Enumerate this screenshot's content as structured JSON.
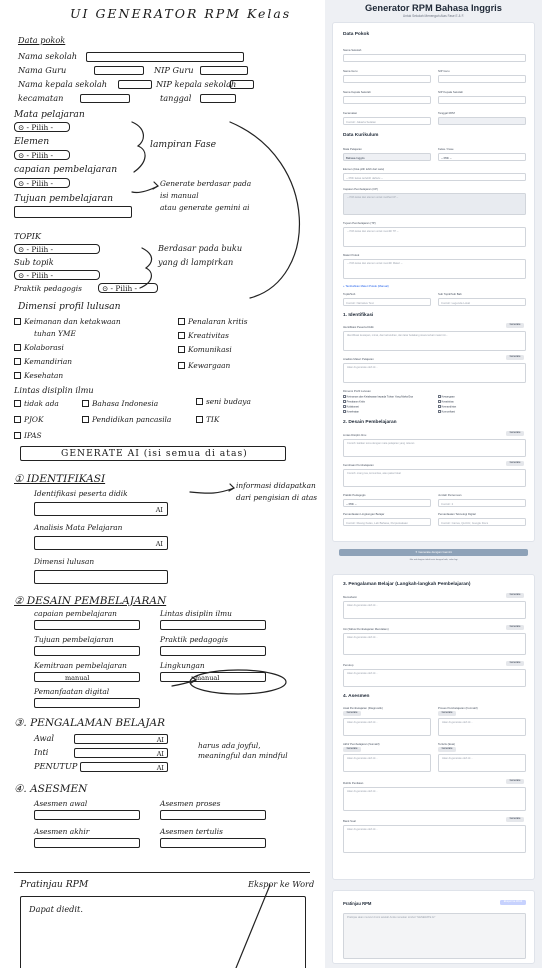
{
  "sketch": {
    "title": "UI GENERATOR RPM Kelas",
    "data_pokok": "Data pokok",
    "nama_sekolah": "Nama sekolah",
    "nama_guru": "Nama Guru",
    "nip_guru": "NIP Guru",
    "nama_kepsek": "Nama kepala sekolah",
    "nip_kepsek": "NIP kepala sekolah",
    "kecamatan": "kecamatan",
    "tanggal": "tanggal",
    "mata_pelajaran": "Mata pelajaran",
    "pilih": "⊙ - Pilih -",
    "elemen": "Elemen",
    "capaian": "capaian pembelajaran",
    "tujuan": "Tujuan pembelajaran",
    "lampiran_fase": "lampiran Fase",
    "generate_note1": "Generate berdasar pada",
    "generate_note2": "isi manual",
    "generate_note3": "atau generate gemini ai",
    "topik": "TOPIK",
    "sub_topik": "Sub topik",
    "praktik": "Praktik pedagogis",
    "buku_note1": "Berdasar pada buku",
    "buku_note2": "yang di lampirkan",
    "dimensi": "Dimensi profil lulusan",
    "dim_items": [
      "Keimanan dan ketakwaan",
      "tuhan YME",
      "Kolaborasi",
      "Kemandirian",
      "Kesehatan",
      "Penalaran kritis",
      "Kreativitas",
      "Komunikasi",
      "Kewargaan"
    ],
    "lintas": "Lintas disiplin ilmu",
    "lintas_items": [
      "tidak ada",
      "Bahasa Indonesia",
      "seni budaya",
      "PJOK",
      "Pendidikan pancasila",
      "TIK",
      "IPAS"
    ],
    "generate_ai": "GENERATE AI (isi semua di atas)",
    "s1": "① IDENTIFIKASI",
    "identifikasi_peserta": "Identifikasi peserta didik",
    "analisis_mapel": "Analisis Mata Pelajaran",
    "dimensi_lulusan": "Dimensi lulusan",
    "ai": "AI",
    "info_note1": "informasi didapatkan",
    "info_note2": "dari pengisian di atas",
    "s2": "② DESAIN PEMBELAJARAN",
    "capaian_pemb": "capaian pembelajaran",
    "lintas_ilmu": "Lintas disiplin ilmu",
    "tujuan_pemb": "Tujuan pembelajaran",
    "praktik_ped": "Praktik pedagogis",
    "kemitraan": "Kemitraan pembelajaran",
    "lingkungan": "Lingkungan",
    "manual": "manual",
    "pemanfaatan": "Pemanfaatan digital",
    "s3": "③. PENGALAMAN BELAJAR",
    "awal": "Awal",
    "inti": "Inti",
    "penutup": "PENUTUP",
    "joyful_note1": "harus ada joyful,",
    "joyful_note2": "meaningful dan mindful",
    "s4": "④. ASESMEN",
    "asesmen_awal": "Asesmen awal",
    "asesmen_proses": "Asesmen proses",
    "asesmen_akhir": "Asesmen akhir",
    "asesmen_tertulis": "Asesmen tertulis",
    "pratinjau": "Pratinjau RPM",
    "ekspor": "Ekspor ke Word",
    "dapat_diedit": "Dapat diedit."
  },
  "app": {
    "title": "Generator RPM Bahasa Inggris",
    "subtitle": "Untuk Sekolah Menengah Atas Fase E & F.",
    "data_pokok": "Data Pokok",
    "nama_sekolah": "Nama Sekolah",
    "nama_guru": "Nama Guru",
    "nip_guru": "NIP Guru",
    "nama_kepsek": "Nama Kepala Sekolah",
    "nip_kepsek": "NIP Kepala Sekolah",
    "kecamatan": "Kecamatan",
    "kecamatan_ph": "Contoh: Jakarta Selatan",
    "tanggal": "Tanggal RPM",
    "data_kurikulum": "Data Kurikulum",
    "mata_pelajaran": "Mata Pelajaran",
    "mapel_value": "Bahasa Inggris",
    "kelas": "Kelas / Fase",
    "kelas_value": "-- Pilih --",
    "elemen": "Elemen (bisa pilih lebih dari satu)",
    "elemen_value": "-- Pilih kelas terlebih dahulu --",
    "capaian": "Capaian Pembelajaran (CP)",
    "capaian_ph": "-- Pilih kelas dan elemen untuk melihat CP --",
    "tujuan": "Tujuan Pembelajaran (TP)",
    "tujuan_ph": "-- Pilih kelas dan elemen untuk memilih TP --",
    "materi": "Materi Pokok",
    "materi_ph": "-- Pilih kelas dan elemen untuk memilih Materi --",
    "tambah_materi": "+ Tambahkan Materi Pokok (Manual)",
    "topik": "Topik/Sub",
    "topik_ph": "Contoh: Narrative Text",
    "sub_topik": "Sub Topik/Sub Bab",
    "sub_topik_ph": "Contoh: Legenda Lokal",
    "s1": "1. Identifikasi",
    "identifikasi": "Identifikasi Peserta Didik",
    "identifikasi_ph": "Identifikasi kesiapan, minat, dan kebutuhan, dan latar belakang siswa terkait materi ini...",
    "analisis": "Analisis Materi Pelajaran",
    "analisis_ph": "Akan di-generate oleh AI...",
    "dimensi": "Dimensi Profil Lulusan",
    "dim_items": [
      "Keimanan dan Ketakwaan kepada Tuhan Yang Maha Esa",
      "Kewargaan",
      "Penalaran Kritis",
      "Kreativitas",
      "Kolaborasi",
      "Kemandirian",
      "Kesehatan",
      "Komunikasi"
    ],
    "s2": "2. Desain Pembelajaran",
    "lintas": "Lintas Disiplin Ilmu",
    "lintas_ph": "Contoh: kaitkan tema dengan mata pelajaran yang relevan",
    "kemitraan": "Kemitraan Pembelajaran",
    "kemitraan_ph": "Contoh: orang tua, komunitas, atau pakar lokal",
    "praktik": "Praktik Pedagogis",
    "praktik_value": "-- Pilih --",
    "jumlah": "Jumlah Pertemuan",
    "jumlah_ph": "Contoh: 2",
    "lingkungan": "Pemanfaatan Lingkungan Belajar",
    "lingkungan_ph": "Contoh: Ruang Kelas, Lab Bahasa, Perpustakaan",
    "digital": "Pemanfaatan Teknologi Digital",
    "digital_ph": "Contoh: Canva, Quizizz, Google Docs",
    "generate_btn": "✦ Generate dengan Gemini",
    "generate_note": "Jika ada bagian tidak terisi dengan baik, coba lagi",
    "s3": "3. Pengalaman Belajar (Langkah-langkah Pembelajaran)",
    "awal": "Memahami",
    "awal_ph": "Akan di-generate oleh AI...",
    "inti": "Inti (Siklus Pembelajaran Mendalam)",
    "inti_ph": "Akan di-generate oleh AI...",
    "penutup": "Penutup",
    "penutup_ph": "Akan di-generate oleh AI...",
    "s4": "4. Asesmen",
    "as_awal": "Awal Pembelajaran (Diagnostik)",
    "as_proses": "Proses Pembelajaran (Formatif)",
    "as_akhir": "Akhir Pembelajaran (Sumatif)",
    "as_tertulis": "Tertulis (Esai)",
    "as_ph": "Akan di-generate oleh AI...",
    "rubrik": "Rubrik Penilaian",
    "soal": "Bank Soal",
    "regen": "Generate",
    "pratinjau": "Pratinjau RPM",
    "ekspor": "Ekspor ke Word",
    "pratinjau_ph": "Pratinjau akan muncul di sini setelah Anda menekan tombol \"GENERATE AI\""
  }
}
